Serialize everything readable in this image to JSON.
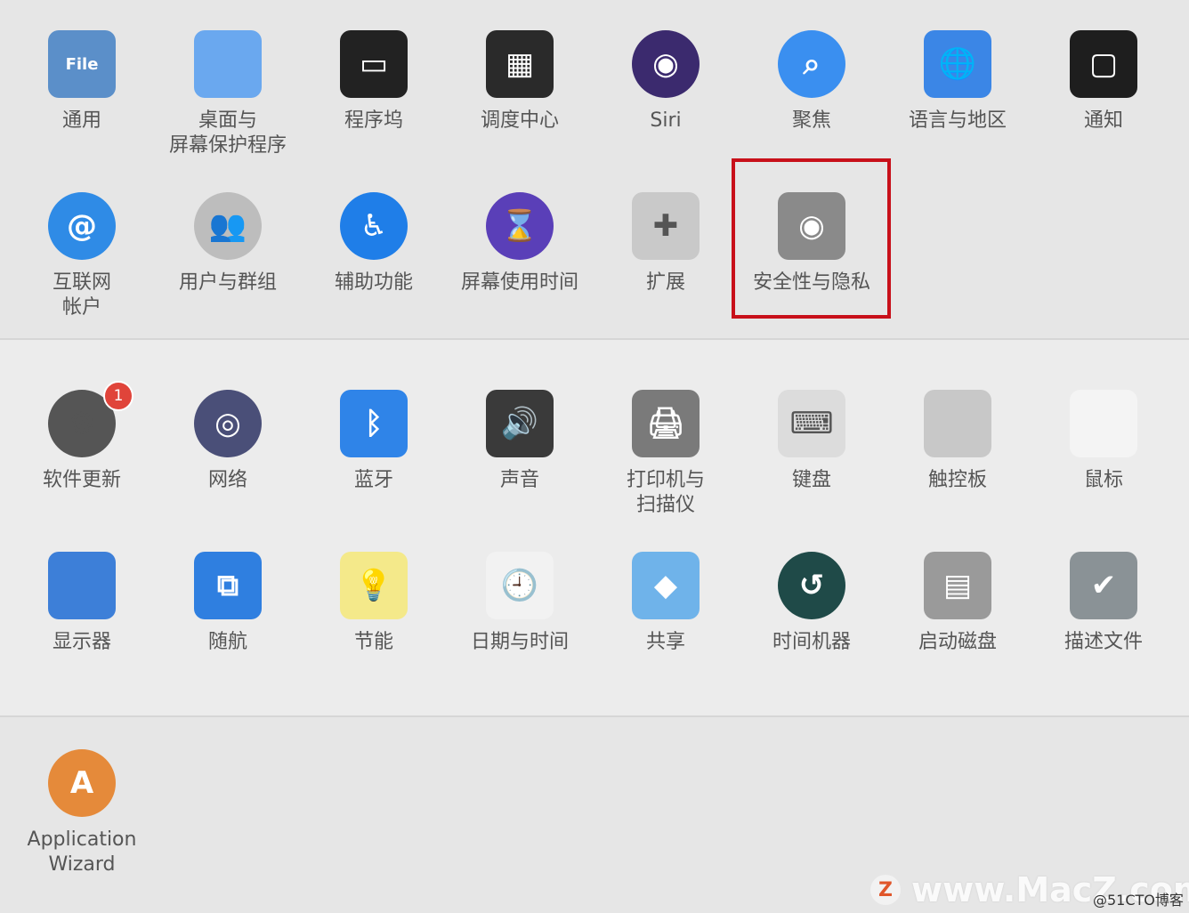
{
  "sections": [
    {
      "items": [
        {
          "label": "通用",
          "icon": "general-icon",
          "color": "#5b8fc9",
          "glyph": "File"
        },
        {
          "label": "桌面与\n屏幕保护程序",
          "icon": "desktop-screensaver-icon",
          "color": "#6aa8ef",
          "glyph": ""
        },
        {
          "label": "程序坞",
          "icon": "dock-icon",
          "color": "#222222",
          "glyph": "▭"
        },
        {
          "label": "调度中心",
          "icon": "mission-control-icon",
          "color": "#2a2a2a",
          "glyph": "▦"
        },
        {
          "label": "Siri",
          "icon": "siri-icon",
          "color": "#3b2a6e",
          "glyph": "◉"
        },
        {
          "label": "聚焦",
          "icon": "spotlight-icon",
          "color": "#3a8ff0",
          "glyph": "⌕"
        },
        {
          "label": "语言与地区",
          "icon": "language-region-icon",
          "color": "#3b86e6",
          "glyph": "🌐"
        },
        {
          "label": "通知",
          "icon": "notifications-icon",
          "color": "#1e1e1e",
          "glyph": "▢"
        }
      ]
    },
    {
      "items": [
        {
          "label": "互联网\n帐户",
          "icon": "internet-accounts-icon",
          "color": "#2f8be6",
          "glyph": "@"
        },
        {
          "label": "用户与群组",
          "icon": "users-groups-icon",
          "color": "#bdbdbd",
          "glyph": "👥"
        },
        {
          "label": "辅助功能",
          "icon": "accessibility-icon",
          "color": "#1f7ee8",
          "glyph": "♿"
        },
        {
          "label": "屏幕使用时间",
          "icon": "screen-time-icon",
          "color": "#5a3fb8",
          "glyph": "⌛"
        },
        {
          "label": "扩展",
          "icon": "extensions-icon",
          "color": "#c9c9c9",
          "glyph": "✚"
        },
        {
          "label": "安全性与隐私",
          "icon": "security-privacy-icon",
          "color": "#8a8a8a",
          "glyph": "◉"
        }
      ]
    },
    {
      "items": [
        {
          "label": "软件更新",
          "icon": "software-update-icon",
          "color": "#555555",
          "glyph": "⚙",
          "badge": "1"
        },
        {
          "label": "网络",
          "icon": "network-icon",
          "color": "#4a4f78",
          "glyph": "◎"
        },
        {
          "label": "蓝牙",
          "icon": "bluetooth-icon",
          "color": "#2f84e8",
          "glyph": "ᛒ"
        },
        {
          "label": "声音",
          "icon": "sound-icon",
          "color": "#3a3a3a",
          "glyph": "🔊"
        },
        {
          "label": "打印机与\n扫描仪",
          "icon": "printers-scanners-icon",
          "color": "#7a7a7a",
          "glyph": "🖨"
        },
        {
          "label": "键盘",
          "icon": "keyboard-icon",
          "color": "#dcdcdc",
          "glyph": "⌨"
        },
        {
          "label": "触控板",
          "icon": "trackpad-icon",
          "color": "#c8c8c8",
          "glyph": ""
        },
        {
          "label": "鼠标",
          "icon": "mouse-icon",
          "color": "#f4f4f4",
          "glyph": ""
        }
      ]
    },
    {
      "items": [
        {
          "label": "显示器",
          "icon": "displays-icon",
          "color": "#3d7fd8",
          "glyph": ""
        },
        {
          "label": "随航",
          "icon": "sidecar-icon",
          "color": "#2f7fe0",
          "glyph": "⧉"
        },
        {
          "label": "节能",
          "icon": "energy-saver-icon",
          "color": "#f4e98a",
          "glyph": "💡"
        },
        {
          "label": "日期与时间",
          "icon": "date-time-icon",
          "color": "#f2f2f2",
          "glyph": "🕘"
        },
        {
          "label": "共享",
          "icon": "sharing-icon",
          "color": "#6fb3ea",
          "glyph": "◆"
        },
        {
          "label": "时间机器",
          "icon": "time-machine-icon",
          "color": "#1f4a48",
          "glyph": "↺"
        },
        {
          "label": "启动磁盘",
          "icon": "startup-disk-icon",
          "color": "#9a9a9a",
          "glyph": "▤"
        },
        {
          "label": "描述文件",
          "icon": "profiles-icon",
          "color": "#8a9296",
          "glyph": "✔"
        }
      ]
    },
    {
      "items": [
        {
          "label": "Application\nWizard",
          "icon": "application-wizard-icon",
          "color": "#e58a3a",
          "glyph": "A"
        }
      ]
    }
  ],
  "watermark": {
    "logo": "Z",
    "text": "www.MacZ.com",
    "credit": "@51CTO博客"
  }
}
